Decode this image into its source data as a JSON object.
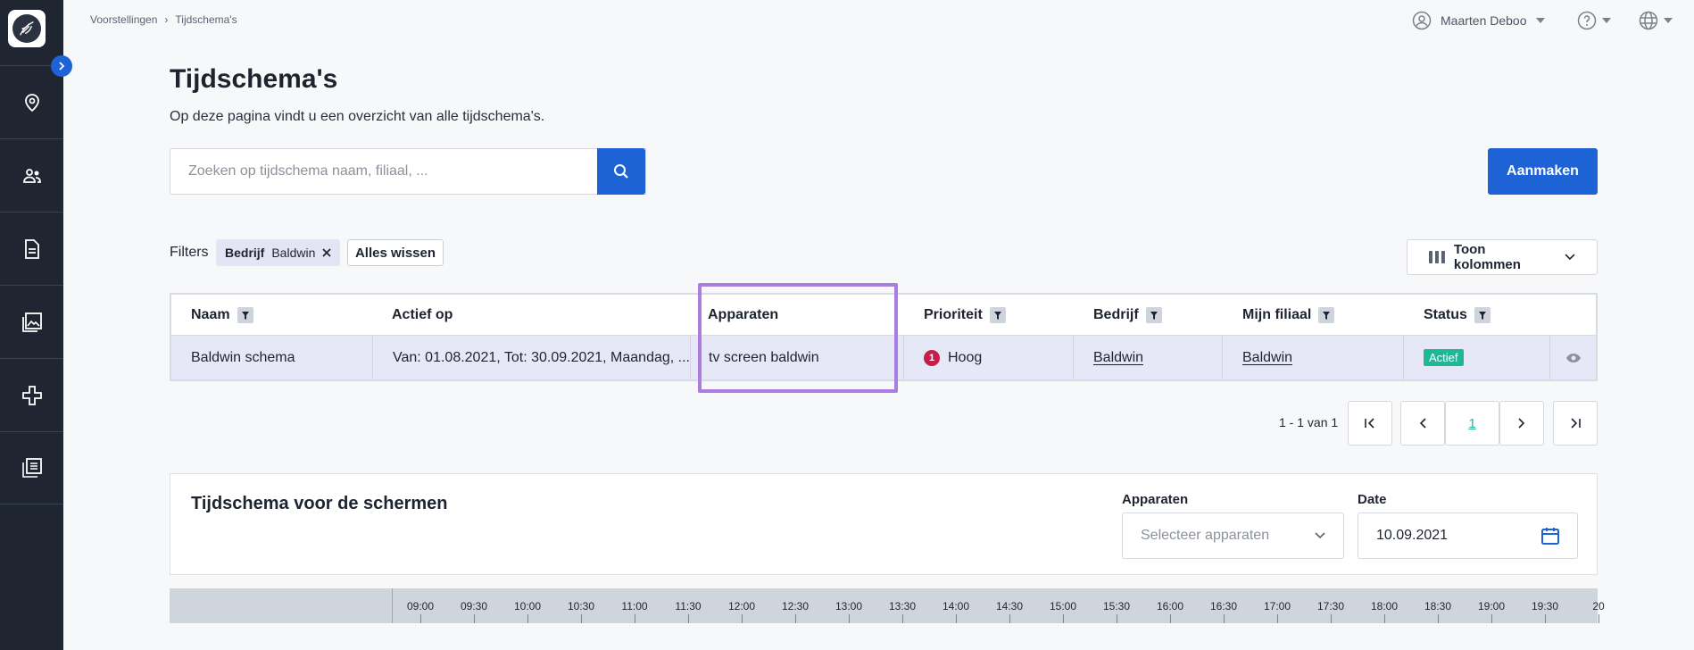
{
  "breadcrumb": {
    "items": [
      "Voorstellingen",
      "Tijdschema's"
    ]
  },
  "user": {
    "name": "Maarten Deboo"
  },
  "page": {
    "title": "Tijdschema's",
    "subtitle": "Op deze pagina vindt u een overzicht van alle tijdschema's."
  },
  "search": {
    "placeholder": "Zoeken op tijdschema naam, filiaal, ..."
  },
  "actions": {
    "create": "Aanmaken",
    "columns": "Toon kolommen"
  },
  "filters": {
    "label": "Filters",
    "chip": {
      "key": "Bedrijf",
      "value": "Baldwin"
    },
    "clear": "Alles wissen"
  },
  "table": {
    "headers": {
      "name": "Naam",
      "active_on": "Actief op",
      "devices": "Apparaten",
      "priority": "Prioriteit",
      "company": "Bedrijf",
      "branch": "Mijn filiaal",
      "status": "Status"
    },
    "rows": [
      {
        "name": "Baldwin schema",
        "active_on": "Van: 01.08.2021, Tot: 30.09.2021, Maandag, ...",
        "devices": "tv screen baldwin",
        "priority_level": "1",
        "priority": "Hoog",
        "company": "Baldwin",
        "branch": "Baldwin",
        "status": "Actief"
      }
    ]
  },
  "pagination": {
    "info": "1 - 1 van 1",
    "current": "1"
  },
  "schedule": {
    "title": "Tijdschema voor de schermen",
    "devices_label": "Apparaten",
    "devices_placeholder": "Selecteer apparaten",
    "date_label": "Date",
    "date_value": "10.09.2021"
  },
  "timeline": {
    "ticks": [
      "09:00",
      "09:30",
      "10:00",
      "10:30",
      "11:00",
      "11:30",
      "12:00",
      "12:30",
      "13:00",
      "13:30",
      "14:00",
      "14:30",
      "15:00",
      "15:30",
      "16:00",
      "16:30",
      "17:00",
      "17:30",
      "18:00",
      "18:30",
      "19:00",
      "19:30",
      "20"
    ]
  },
  "colors": {
    "primary": "#1d63d6",
    "sidebar": "#1f2632",
    "status_active": "#1cb899",
    "priority_high": "#c41f4a",
    "highlight": "#a97ee0",
    "row_selected": "#e7e8f7"
  }
}
